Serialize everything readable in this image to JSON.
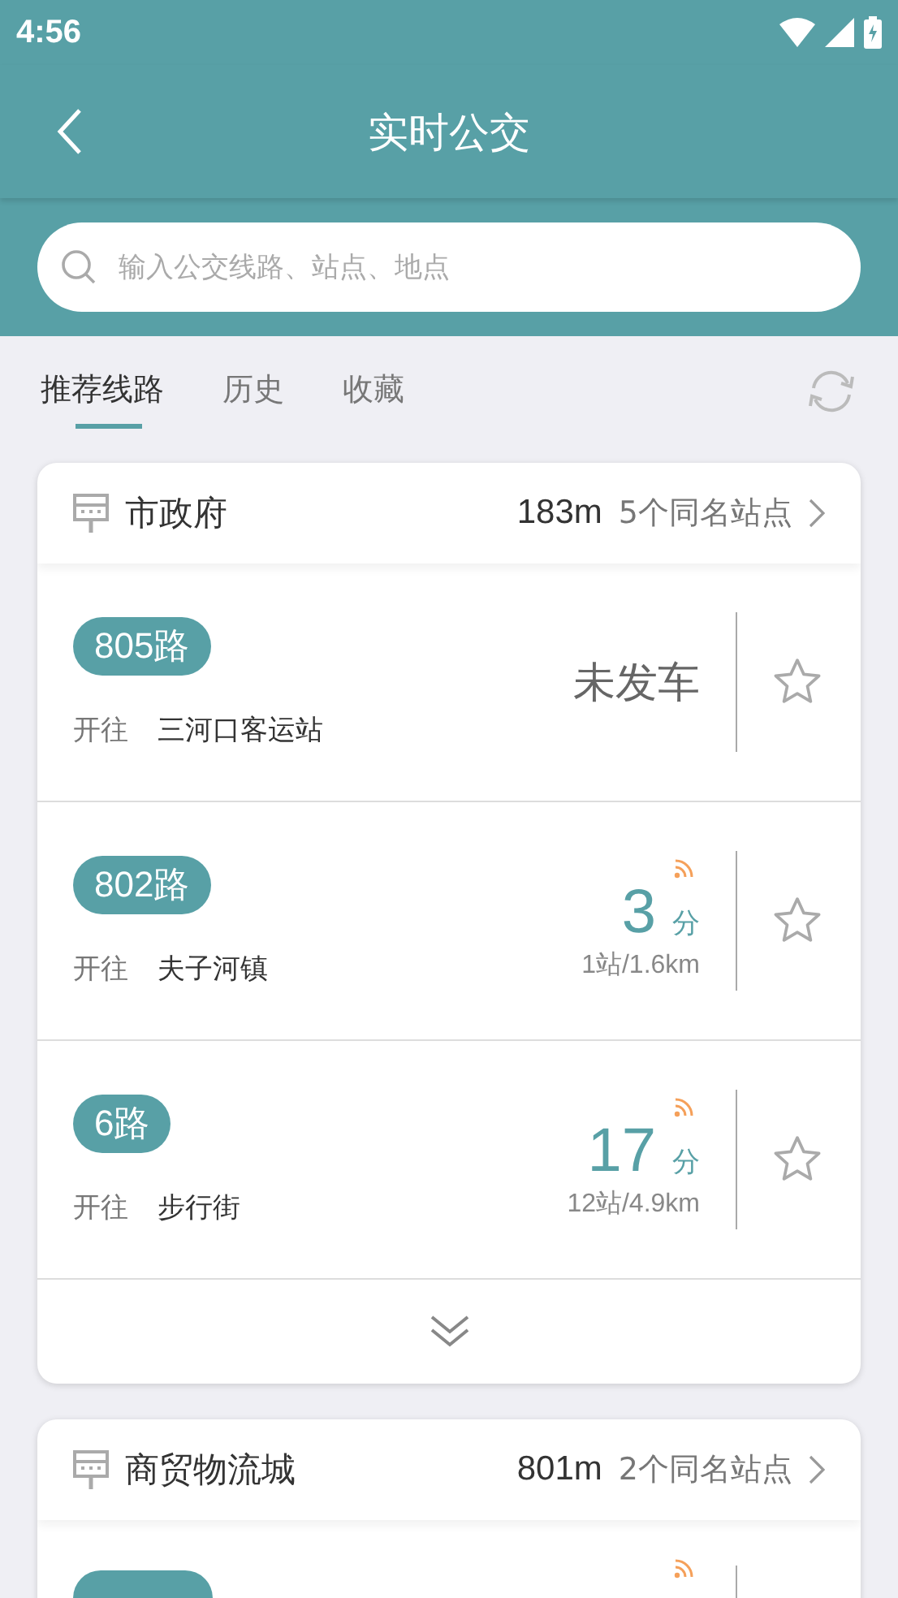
{
  "status_bar": {
    "time": "4:56"
  },
  "header": {
    "title": "实时公交"
  },
  "search": {
    "placeholder": "输入公交线路、站点、地点"
  },
  "tabs": [
    {
      "label": "推荐线路",
      "selected": true
    },
    {
      "label": "历史",
      "selected": false
    },
    {
      "label": "收藏",
      "selected": false
    }
  ],
  "stops": [
    {
      "name": "市政府",
      "distance": "183m",
      "same_name": "5个同名站点",
      "expandable": true,
      "routes": [
        {
          "kind": "not_departed",
          "line": "805路",
          "direction_label": "开往",
          "destination": "三河口客运站",
          "status": "未发车",
          "starred": false
        },
        {
          "kind": "arriving",
          "line": "802路",
          "direction_label": "开往",
          "destination": "夫子河镇",
          "minutes": "3",
          "unit": "分",
          "detail": "1站/1.6km",
          "starred": false
        },
        {
          "kind": "arriving",
          "line": "6路",
          "direction_label": "开往",
          "destination": "步行街",
          "minutes": "17",
          "unit": "分",
          "detail": "12站/4.9km",
          "starred": false
        }
      ]
    },
    {
      "name": "商贸物流城",
      "distance": "801m",
      "same_name": "2个同名站点",
      "routes": [
        {
          "kind": "partial"
        }
      ]
    }
  ]
}
